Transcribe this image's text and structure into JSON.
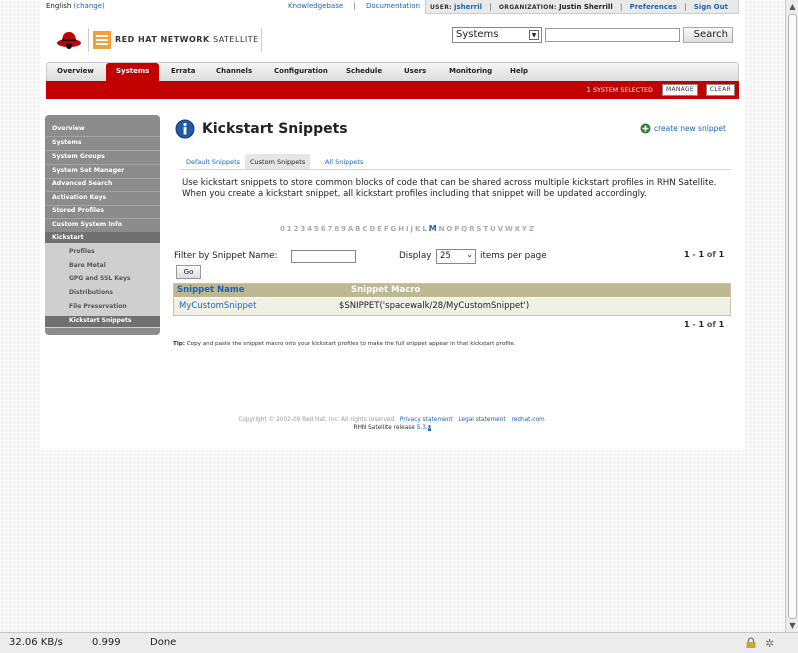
{
  "topbar": {
    "language": "English",
    "change_label": "(change)",
    "knowledgebase_label": "Knowledgebase",
    "separator": "|",
    "documentation_label": "Documentation",
    "user_key": "USER:",
    "user_value": "jsherril",
    "org_key": "ORGANIZATION:",
    "org_value": "Justin Sherrill",
    "preferences_label": "Preferences",
    "signout_label": "Sign Out"
  },
  "logo": {
    "brand_bold": "RED HAT NETWORK",
    "brand_light": "SATELLITE"
  },
  "search": {
    "scope_value": "Systems",
    "query_value": "",
    "button_label": "Search"
  },
  "nav": {
    "items": [
      {
        "label": "Overview"
      },
      {
        "label": "Systems"
      },
      {
        "label": "Errata"
      },
      {
        "label": "Channels"
      },
      {
        "label": "Configuration"
      },
      {
        "label": "Schedule"
      },
      {
        "label": "Users"
      },
      {
        "label": "Monitoring"
      },
      {
        "label": "Help"
      }
    ],
    "active": "Systems"
  },
  "selection": {
    "count": "1",
    "text": "system selected",
    "manage_label": "Manage",
    "clear_label": "Clear"
  },
  "sidebar": {
    "items": [
      {
        "label": "Overview"
      },
      {
        "label": "Systems"
      },
      {
        "label": "System Groups"
      },
      {
        "label": "System Set Manager"
      },
      {
        "label": "Advanced Search"
      },
      {
        "label": "Activation Keys"
      },
      {
        "label": "Stored Profiles"
      },
      {
        "label": "Custom System Info"
      },
      {
        "label": "Kickstart"
      }
    ],
    "subitems": [
      {
        "label": "Profiles"
      },
      {
        "label": "Bare Metal"
      },
      {
        "label": "GPG and SSL Keys"
      },
      {
        "label": "Distributions"
      },
      {
        "label": "File Preservation"
      },
      {
        "label": "Kickstart Snippets"
      }
    ],
    "active_subitem": "Kickstart Snippets"
  },
  "main": {
    "title": "Kickstart Snippets",
    "create_label": "create new snippet",
    "tabs": [
      {
        "label": "Default Snippets"
      },
      {
        "label": "Custom Snippets"
      },
      {
        "label": "All Snippets"
      }
    ],
    "active_tab": "Custom Snippets",
    "description": "Use kickstart snippets to store common blocks of code that can be shared across multiple kickstart profiles in RHN Satellite. When you create a kickstart snippet, all kickstart profiles including that snippet will be updated accordingly.",
    "alphabet": [
      "0",
      "1",
      "2",
      "3",
      "4",
      "5",
      "6",
      "7",
      "8",
      "9",
      "A",
      "B",
      "C",
      "D",
      "E",
      "F",
      "G",
      "H",
      "I",
      "J",
      "K",
      "L",
      "M",
      "N",
      "O",
      "P",
      "Q",
      "R",
      "S",
      "T",
      "U",
      "V",
      "W",
      "X",
      "Y",
      "Z"
    ],
    "alphabet_active": "M",
    "filter_label": "Filter by Snippet Name:",
    "filter_value": "",
    "go_label": "Go",
    "display_label": "Display",
    "display_value": "25",
    "per_page_label": "items per page",
    "range_start": "1",
    "range_sep": " - ",
    "range_end": "1",
    "range_of": " of ",
    "range_total": "1",
    "table": {
      "columns": [
        "Snippet Name",
        "Snippet Macro"
      ],
      "rows": [
        {
          "name": "MyCustomSnippet",
          "macro": "$SNIPPET('spacewalk/28/MyCustomSnippet')"
        }
      ]
    },
    "tip_label": "Tip:",
    "tip_text": "Copy and paste the snippet macro into your kickstart profiles to make the full snippet appear in that kickstart profile."
  },
  "footer": {
    "copyright": "Copyright © 2002-09 Red Hat, Inc. All rights reserved.",
    "privacy_label": "Privacy statement",
    "legal_label": "Legal statement",
    "redhat_label": "redhat.com",
    "release_label": "RHN Satellite release",
    "version_main": "5.3.",
    "version_sel": "0"
  },
  "statusbar": {
    "speed": "32.06 KB/s",
    "ratio": "0.999",
    "status": "Done"
  },
  "colors": {
    "brand_red": "#c10000",
    "link_blue": "#1b66b6",
    "sidebar_gray": "#8c8c8c",
    "table_header": "#bdb792"
  }
}
